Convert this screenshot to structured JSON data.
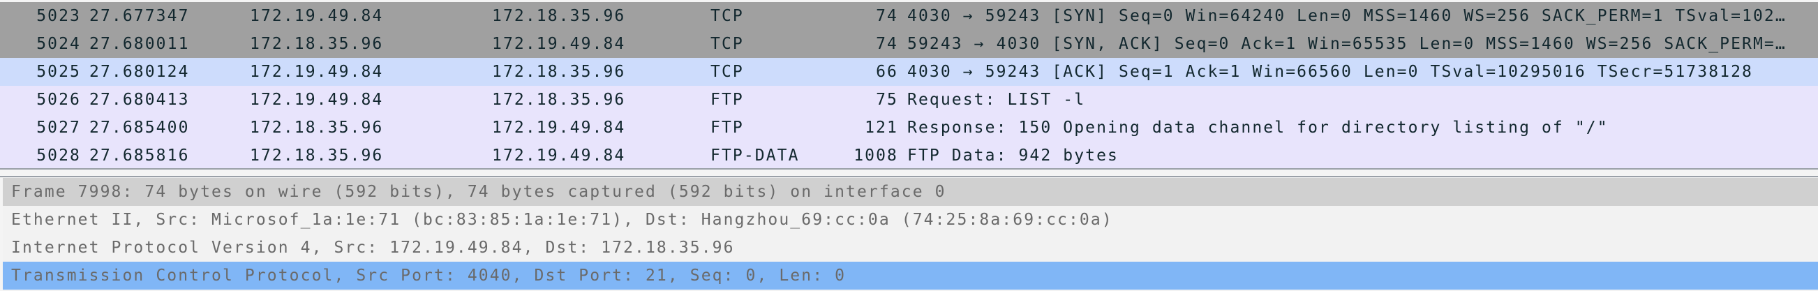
{
  "colors": {
    "tcp_syn_row": "#a0a0a0",
    "selected_row": "#cddcfc",
    "default_row": "#e8e4fc",
    "detail_frame": "#d0d0d0",
    "detail_normal": "#f2f2f2",
    "detail_selected": "#80b6f6"
  },
  "packets": [
    {
      "no": "5023",
      "time": "27.677347",
      "src": "172.19.49.84",
      "dst": "172.18.35.96",
      "proto": "TCP",
      "len": "74",
      "info": "4030 → 59243 [SYN] Seq=0 Win=64240 Len=0 MSS=1460 WS=256 SACK_PERM=1 TSval=102…",
      "bg": "#a0a0a0"
    },
    {
      "no": "5024",
      "time": "27.680011",
      "src": "172.18.35.96",
      "dst": "172.19.49.84",
      "proto": "TCP",
      "len": "74",
      "info": "59243 → 4030 [SYN, ACK] Seq=0 Ack=1 Win=65535 Len=0 MSS=1460 WS=256 SACK_PERM=…",
      "bg": "#a0a0a0"
    },
    {
      "no": "5025",
      "time": "27.680124",
      "src": "172.19.49.84",
      "dst": "172.18.35.96",
      "proto": "TCP",
      "len": "66",
      "info": "4030 → 59243 [ACK] Seq=1 Ack=1 Win=66560 Len=0 TSval=10295016 TSecr=51738128",
      "bg": "#cddcfc"
    },
    {
      "no": "5026",
      "time": "27.680413",
      "src": "172.19.49.84",
      "dst": "172.18.35.96",
      "proto": "FTP",
      "len": "75",
      "info": "Request: LIST -l",
      "bg": "#e8e4fc"
    },
    {
      "no": "5027",
      "time": "27.685400",
      "src": "172.18.35.96",
      "dst": "172.19.49.84",
      "proto": "FTP",
      "len": "121",
      "info": "Response: 150 Opening data channel for directory listing of \"/\"",
      "bg": "#e8e4fc"
    },
    {
      "no": "5028",
      "time": "27.685816",
      "src": "172.18.35.96",
      "dst": "172.19.49.84",
      "proto": "FTP-DATA",
      "len": "1008",
      "info": "FTP Data: 942 bytes",
      "bg": "#e8e4fc"
    }
  ],
  "details": [
    {
      "text": "Frame 7998: 74 bytes on wire (592 bits), 74 bytes captured (592 bits) on interface 0",
      "bg": "#d0d0d0"
    },
    {
      "text": "Ethernet II, Src: Microsof_1a:1e:71 (bc:83:85:1a:1e:71), Dst: Hangzhou_69:cc:0a (74:25:8a:69:cc:0a)",
      "bg": "#f2f2f2"
    },
    {
      "text": "Internet Protocol Version 4, Src: 172.19.49.84, Dst: 172.18.35.96",
      "bg": "#f2f2f2"
    },
    {
      "text": "Transmission Control Protocol, Src Port: 4040, Dst Port: 21, Seq: 0, Len: 0",
      "bg": "#80b6f6",
      "selected": true
    }
  ]
}
